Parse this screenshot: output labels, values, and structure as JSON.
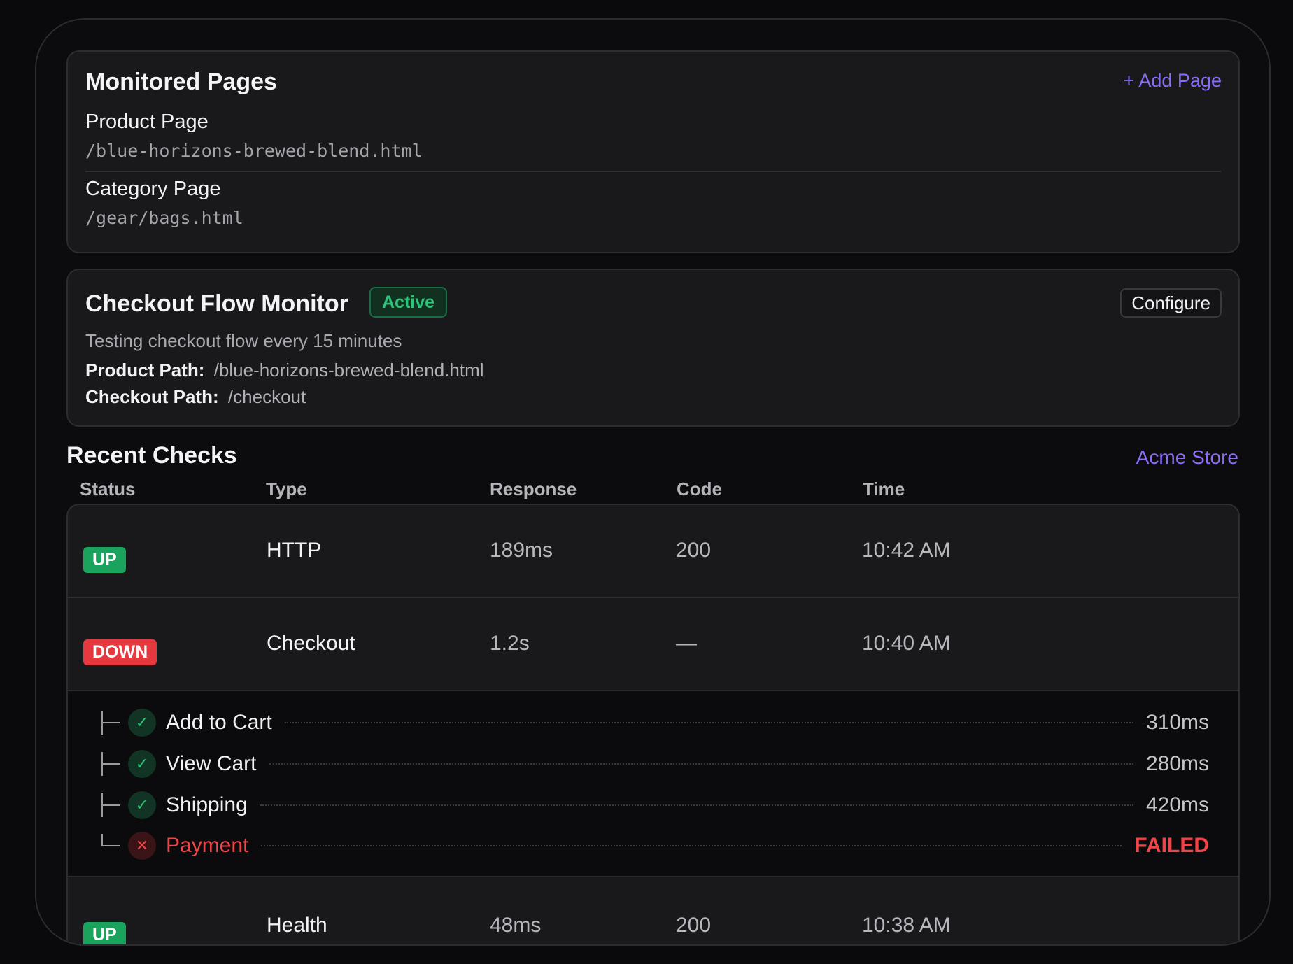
{
  "monitored_pages": {
    "title": "Monitored Pages",
    "add_label": "+ Add Page",
    "pages": [
      {
        "name": "Product Page",
        "path": "/blue-horizons-brewed-blend.html"
      },
      {
        "name": "Category Page",
        "path": "/gear/bags.html"
      }
    ]
  },
  "monitor": {
    "title": "Checkout Flow Monitor",
    "status": "Active",
    "configure_label": "Configure",
    "description": "Testing checkout flow every 15 minutes",
    "product_path_label": "Product Path:",
    "product_path": "/blue-horizons-brewed-blend.html",
    "checkout_path_label": "Checkout Path:",
    "checkout_path": "/checkout"
  },
  "recent_checks": {
    "title": "Recent Checks",
    "store_label": "Acme Store",
    "columns": [
      "Status",
      "Type",
      "Response",
      "Code",
      "Time"
    ],
    "rows": [
      {
        "status": "UP",
        "type": "HTTP",
        "response": "189ms",
        "code": "200",
        "time": "10:42 AM"
      },
      {
        "status": "DOWN",
        "type": "Checkout",
        "response": "1.2s",
        "code": "—",
        "time": "10:40 AM"
      },
      {
        "status": "UP",
        "type": "Health",
        "response": "48ms",
        "code": "200",
        "time": "10:38 AM"
      }
    ],
    "steps": [
      {
        "label": "Add to Cart",
        "duration": "310ms",
        "ok": true
      },
      {
        "label": "View Cart",
        "duration": "280ms",
        "ok": true
      },
      {
        "label": "Shipping",
        "duration": "420ms",
        "ok": true
      },
      {
        "label": "Payment",
        "duration": "FAILED",
        "ok": false
      }
    ]
  },
  "icons": {
    "check": "check-icon",
    "fail": "x-icon"
  },
  "colors": {
    "accent": "#8b6cf6",
    "up": "#1aa35d",
    "down": "#e5393f",
    "active": "#2ec47a"
  }
}
